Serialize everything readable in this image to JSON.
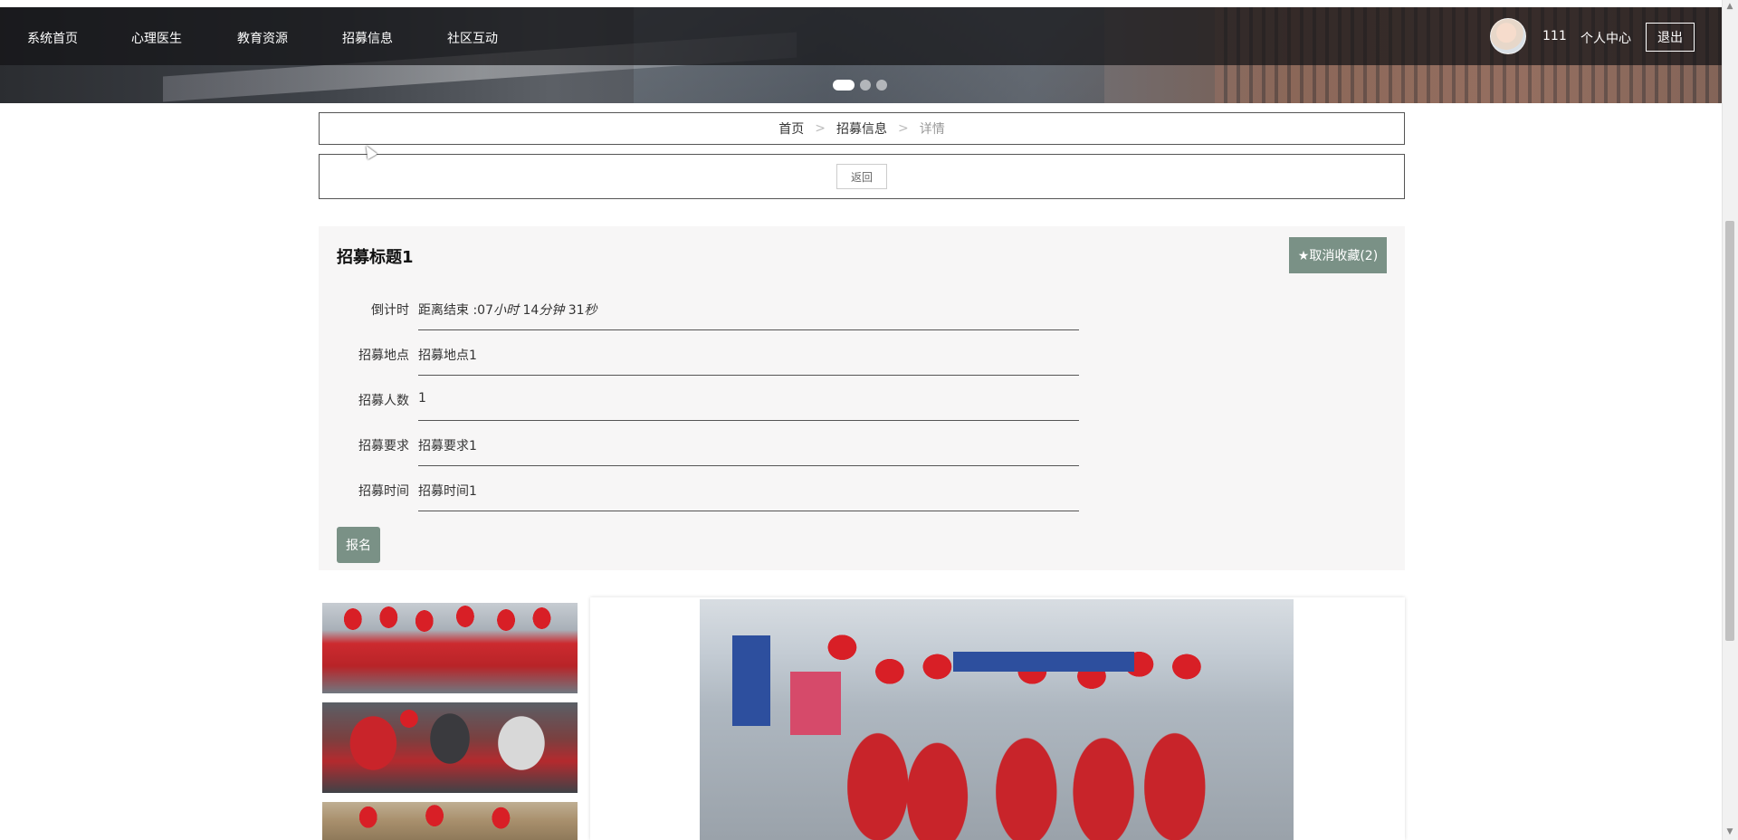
{
  "nav": {
    "items": [
      "系统首页",
      "心理医生",
      "教育资源",
      "招募信息",
      "社区互动"
    ],
    "username": "111",
    "user_center": "个人中心",
    "logout": "退出"
  },
  "breadcrumb": {
    "home": "首页",
    "section": "招募信息",
    "current": "详情",
    "separator": ">"
  },
  "back_label": "返回",
  "detail": {
    "title": "招募标题1",
    "favorite_label": "★取消收藏(2)",
    "countdown_label": "倒计时",
    "countdown_prefix": "距离结束 :07",
    "countdown_hours_unit": "小时",
    "countdown_minutes": "14",
    "countdown_minutes_unit": "分钟",
    "countdown_seconds": "31",
    "countdown_seconds_unit": "秒",
    "fields": [
      {
        "label": "招募地点",
        "value": "招募地点1"
      },
      {
        "label": "招募人数",
        "value": "1"
      },
      {
        "label": "招募要求",
        "value": "招募要求1"
      },
      {
        "label": "招募时间",
        "value": "招募时间1"
      }
    ],
    "signup_label": "报名"
  },
  "colors": {
    "accent": "#7a9186",
    "nav_bg": "#141416",
    "panel_bg": "#f7f6f6"
  },
  "carousel": {
    "slide_count": 3,
    "active_index": 0
  }
}
